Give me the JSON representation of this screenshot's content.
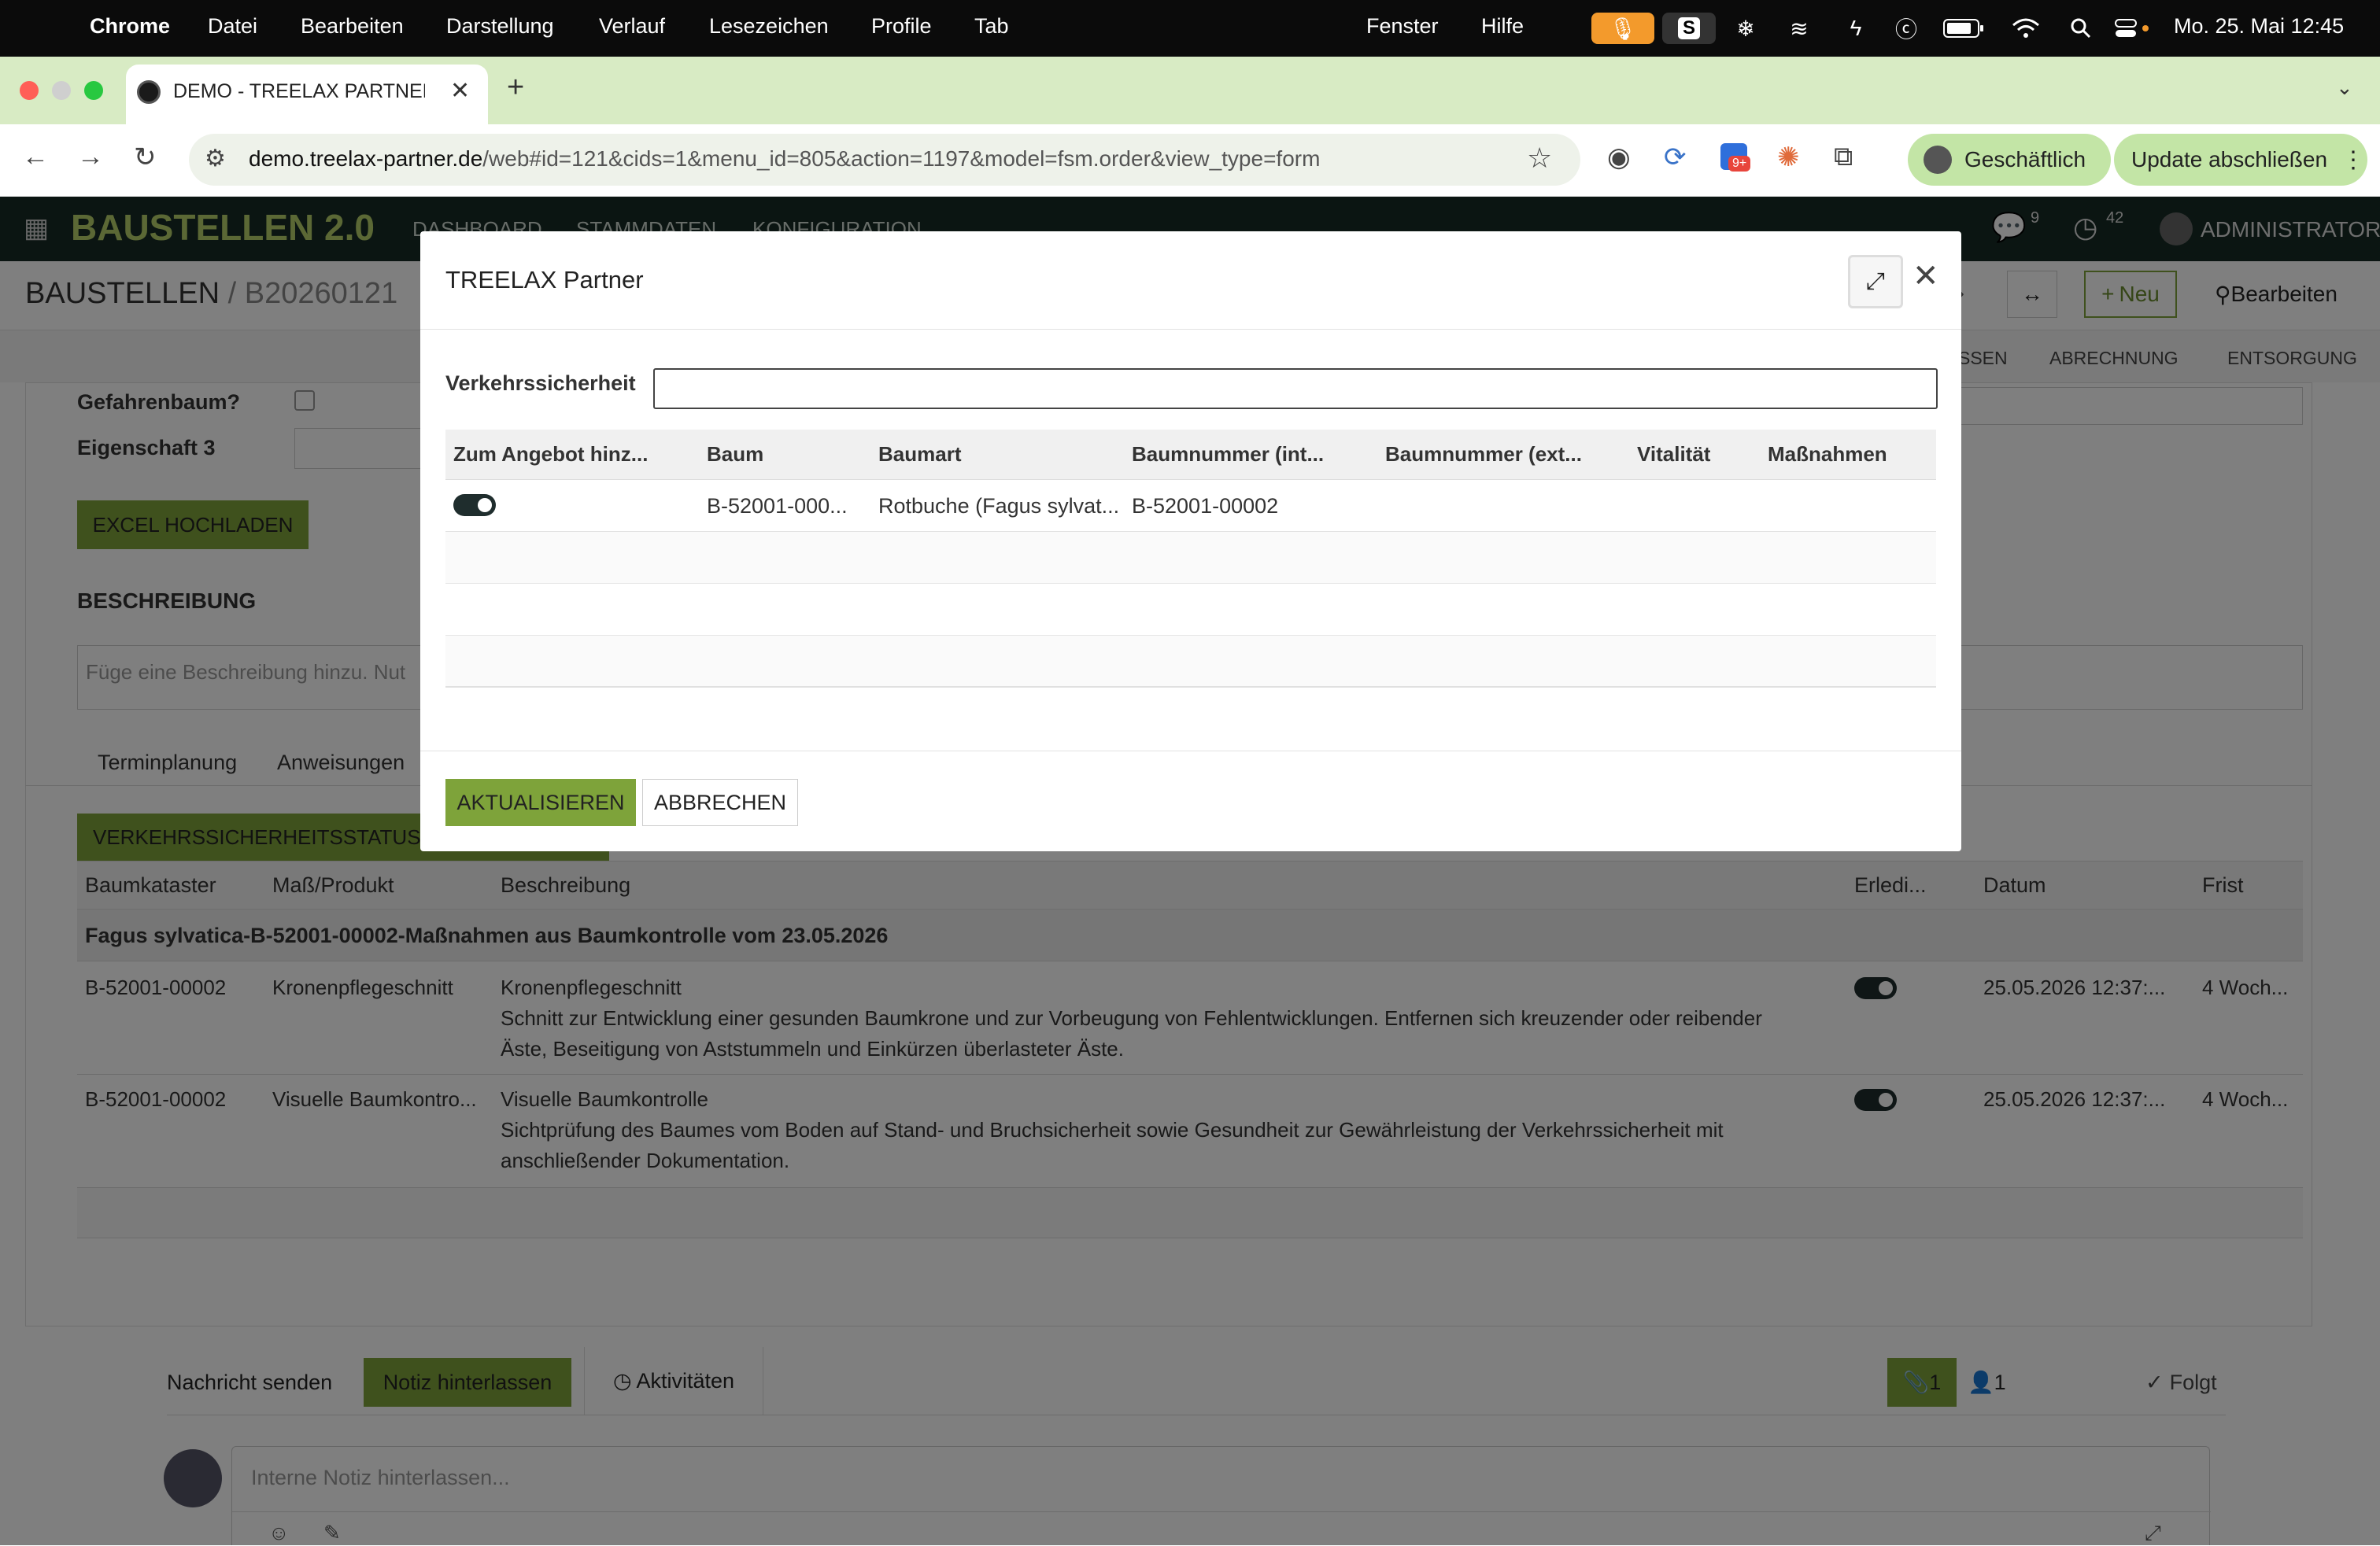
{
  "menubar": {
    "app": "Chrome",
    "items": [
      "Datei",
      "Bearbeiten",
      "Darstellung",
      "Verlauf",
      "Lesezeichen",
      "Profile",
      "Tab"
    ],
    "right_items": [
      "Fenster",
      "Hilfe"
    ],
    "datetime": "Mo. 25. Mai  12:45",
    "s_icon_letter": "S"
  },
  "browser": {
    "tab_title": "DEMO - TREELAX PARTNER -",
    "url_host": "demo.treelax-partner.de",
    "url_path": "/web#id=121&cids=1&menu_id=805&action=1197&model=fsm.order&view_type=form",
    "profile_label": "Geschäftlich",
    "update_label": "Update abschließen",
    "ext_badge": "9+"
  },
  "app": {
    "title": "BAUSTELLEN 2.0",
    "nav": [
      "DASHBOARD",
      "STAMMDATEN",
      "KONFIGURATION"
    ],
    "chat_count": "9",
    "activity_count": "42",
    "user": "ADMINISTRATOR"
  },
  "breadcrumb": {
    "parent": "BAUSTELLEN",
    "separator": "/",
    "current": "B20260121",
    "new_label": "Neu",
    "edit_label": "Bearbeiten",
    "stages": [
      "SSEN",
      "ABRECHNUNG",
      "ENTSORGUNG"
    ]
  },
  "form": {
    "gefahrenbaum_label": "Gefahrenbaum?",
    "eigenschaft_label": "Eigenschaft 3",
    "excel_button": "EXCEL HOCHLADEN",
    "beschreibung_label": "BESCHREIBUNG",
    "beschreibung_placeholder": "Füge eine Beschreibung hinzu. Nut",
    "tabs": [
      "Terminplanung",
      "Anweisungen"
    ],
    "vs_button": "VERKEHRSSICHERHEITSSTATUS",
    "table": {
      "headers": [
        "Baumkataster",
        "Maß/Produkt",
        "Beschreibung",
        "Erledi...",
        "Datum",
        "Frist"
      ],
      "group": "Fagus sylvatica-B-52001-00002-Maßnahmen aus Baumkontrolle vom 23.05.2026",
      "rows": [
        {
          "kataster": "B-52001-00002",
          "produkt": "Kronenpflegeschnitt",
          "title": "Kronenpflegeschnitt",
          "line1": "Schnitt zur Entwicklung einer gesunden Baumkrone und zur Vorbeugung von Fehlentwicklungen. Entfernen sich kreuzender oder reibender",
          "line2": "Äste, Beseitigung von Aststummeln und Einkürzen überlasteter Äste.",
          "datum": "25.05.2026 12:37:...",
          "frist": "4 Woch..."
        },
        {
          "kataster": "B-52001-00002",
          "produkt": "Visuelle Baumkontro...",
          "title": "Visuelle Baumkontrolle",
          "line1": "Sichtprüfung des Baumes vom Boden auf Stand- und Bruchsicherheit sowie Gesundheit zur Gewährleistung der Verkehrssicherheit mit",
          "line2": "anschließender Dokumentation.",
          "datum": "25.05.2026 12:37:...",
          "frist": "4 Woch..."
        }
      ]
    }
  },
  "chatter": {
    "send_message": "Nachricht senden",
    "log_note": "Notiz hinterlassen",
    "activities": "Aktivitäten",
    "attachments_count": "1",
    "followers_count": "1",
    "follow_label": "Folgt",
    "note_placeholder": "Interne Notiz hinterlassen..."
  },
  "modal": {
    "title": "TREELAX Partner",
    "field_label": "Verkehrssicherheit",
    "field_value": "",
    "headers": [
      "Zum Angebot hinz...",
      "Baum",
      "Baumart",
      "Baumnummer (int...",
      "Baumnummer (ext...",
      "Vitalität",
      "Maßnahmen"
    ],
    "rows": [
      {
        "toggle": true,
        "baum": "B-52001-000...",
        "baumart": "Rotbuche (Fagus sylvat...",
        "nr_int": "B-52001-00002",
        "nr_ext": "",
        "vitalitaet": "",
        "massnahmen": ""
      }
    ],
    "update_button": "AKTUALISIEREN",
    "cancel_button": "ABBRECHEN"
  },
  "colors": {
    "accent_green": "#7ea33a",
    "app_bar": "#162b24",
    "toggle_on": "#1f2d2d",
    "chrome_tabstrip": "#d8ebc4"
  }
}
